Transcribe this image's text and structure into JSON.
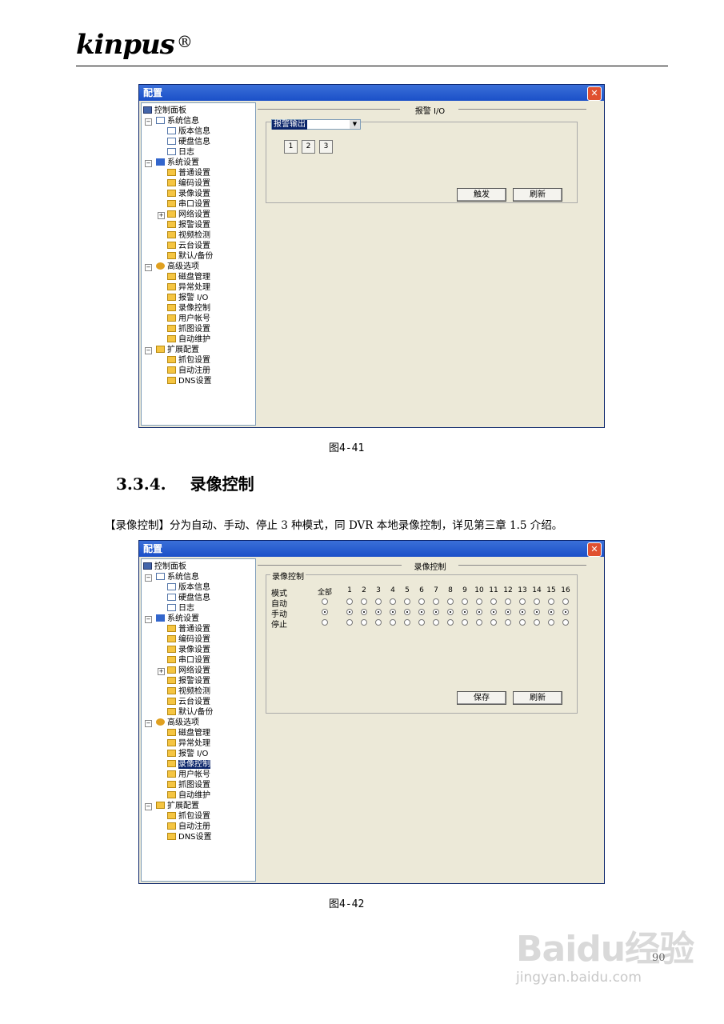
{
  "header": {
    "logo": "kinpus",
    "logo_mark": "®"
  },
  "dialog1": {
    "title": "配置",
    "close": "✕",
    "tree": [
      {
        "label": "控制面板",
        "icon": "pc"
      },
      {
        "label": "系统信息",
        "icon": "note"
      },
      {
        "label": "版本信息",
        "icon": "note"
      },
      {
        "label": "硬盘信息",
        "icon": "note"
      },
      {
        "label": "日志",
        "icon": "note"
      },
      {
        "label": "系统设置",
        "icon": "tool"
      },
      {
        "label": "普通设置",
        "icon": "folder"
      },
      {
        "label": "编码设置",
        "icon": "folder"
      },
      {
        "label": "录像设置",
        "icon": "folder"
      },
      {
        "label": "串口设置",
        "icon": "folder"
      },
      {
        "label": "网络设置",
        "icon": "folder"
      },
      {
        "label": "报警设置",
        "icon": "folder"
      },
      {
        "label": "视频检测",
        "icon": "folder"
      },
      {
        "label": "云台设置",
        "icon": "folder"
      },
      {
        "label": "默认/备份",
        "icon": "folder"
      },
      {
        "label": "高级选项",
        "icon": "gear"
      },
      {
        "label": "磁盘管理",
        "icon": "folder"
      },
      {
        "label": "异常处理",
        "icon": "folder"
      },
      {
        "label": "报警 I/O",
        "icon": "folder"
      },
      {
        "label": "录像控制",
        "icon": "folder"
      },
      {
        "label": "用户帐号",
        "icon": "folder"
      },
      {
        "label": "抓图设置",
        "icon": "folder"
      },
      {
        "label": "自动维护",
        "icon": "folder"
      },
      {
        "label": "扩展配置",
        "icon": "folder"
      },
      {
        "label": "抓包设置",
        "icon": "folder"
      },
      {
        "label": "自动注册",
        "icon": "folder"
      },
      {
        "label": "DNS设置",
        "icon": "folder"
      }
    ],
    "panel_title": "报警 I/O",
    "select_value": "报警输出",
    "output_buttons": [
      "1",
      "2",
      "3"
    ],
    "trigger_label": "触发",
    "refresh_label": "刷新"
  },
  "caption1": "图4-41",
  "section": {
    "number": "3.3.4.",
    "title": "录像控制"
  },
  "paragraph": "【录像控制】分为自动、手动、停止 3 种模式，同 DVR 本地录像控制，详见第三章 1.5 介绍。",
  "dialog2": {
    "title": "配置",
    "close": "✕",
    "panel_title": "录像控制",
    "group_title": "录像控制",
    "mode_label": "模式",
    "all_label": "全部",
    "channels": [
      "1",
      "2",
      "3",
      "4",
      "5",
      "6",
      "7",
      "8",
      "9",
      "10",
      "11",
      "12",
      "13",
      "14",
      "15",
      "16"
    ],
    "rows": [
      {
        "label": "自动",
        "selected": false
      },
      {
        "label": "手动",
        "selected": true
      },
      {
        "label": "停止",
        "selected": false
      }
    ],
    "save_label": "保存",
    "refresh_label": "刷新"
  },
  "caption2": "图4-42",
  "page_number": "90",
  "watermark": {
    "brand": "Baidu经验",
    "url": "jingyan.baidu.com"
  }
}
